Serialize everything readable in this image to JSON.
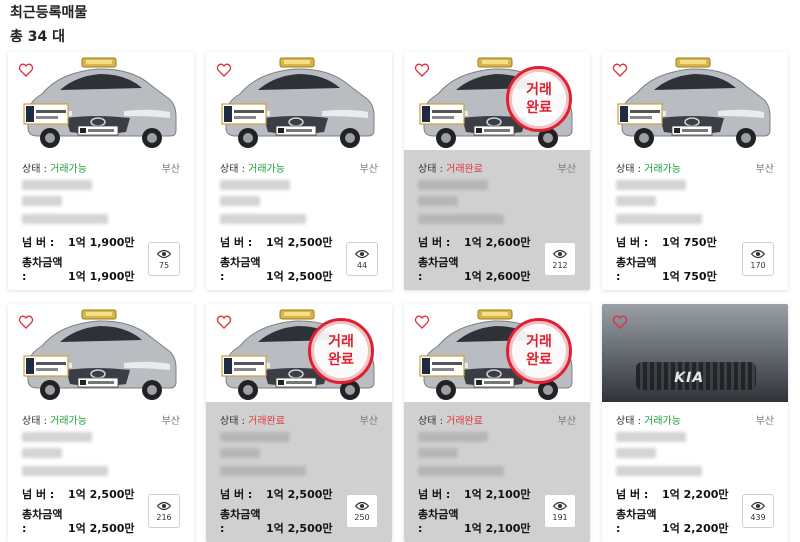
{
  "header": {
    "title": "최근등록매물",
    "count": "총 34 대"
  },
  "labels": {
    "status_prefix": "상태 : ",
    "price1": "넘    버 : ",
    "price2": "총차금액 : "
  },
  "colors": {
    "available": "#1aa138",
    "sold": "#e03a3a",
    "stamp": "#e02030"
  },
  "stamp": {
    "line1": "거래",
    "line2": "완료"
  },
  "cards": [
    {
      "status": "거래가능",
      "sold": false,
      "region": "부산",
      "number_price": "1억 1,900만",
      "total_price": "1억 1,900만",
      "views": "75",
      "image": "taxi-sonata"
    },
    {
      "status": "거래가능",
      "sold": false,
      "region": "부산",
      "number_price": "1억 2,500만",
      "total_price": "1억 2,500만",
      "views": "44",
      "image": "taxi-sonata"
    },
    {
      "status": "거래완료",
      "sold": true,
      "region": "부산",
      "number_price": "1억 2,600만",
      "total_price": "1억 2,600만",
      "views": "212",
      "image": "taxi-sonata"
    },
    {
      "status": "거래가능",
      "sold": false,
      "region": "부산",
      "number_price": "1억 750만",
      "total_price": "1억 750만",
      "views": "170",
      "image": "taxi-sonata"
    },
    {
      "status": "거래가능",
      "sold": false,
      "region": "부산",
      "number_price": "1억 2,500만",
      "total_price": "1억 2,500만",
      "views": "216",
      "image": "taxi-sonata"
    },
    {
      "status": "거래완료",
      "sold": true,
      "region": "부산",
      "number_price": "1억 2,500만",
      "total_price": "1억 2,500만",
      "views": "250",
      "image": "taxi-sonata"
    },
    {
      "status": "거래완료",
      "sold": true,
      "region": "부산",
      "number_price": "1억 2,100만",
      "total_price": "1억 2,100만",
      "views": "191",
      "image": "taxi-sonata"
    },
    {
      "status": "거래가능",
      "sold": false,
      "region": "부산",
      "number_price": "1억 2,200만",
      "total_price": "1억 2,200만",
      "views": "439",
      "image": "kia-k5-photo"
    }
  ]
}
